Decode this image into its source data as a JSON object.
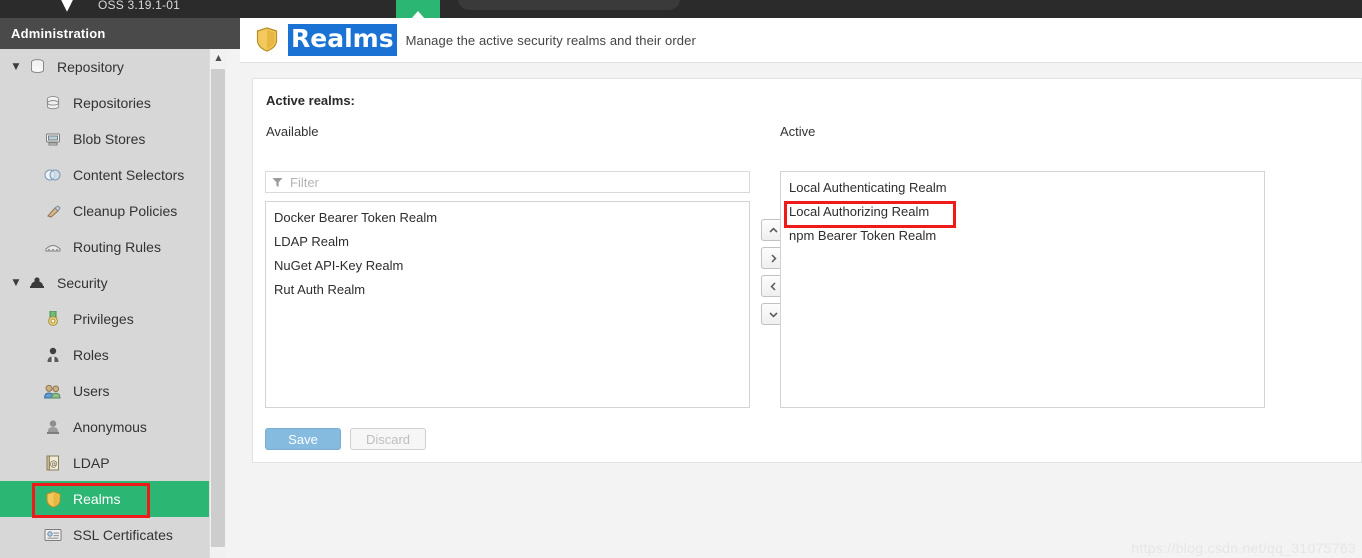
{
  "topbar": {
    "product_version": "OSS 3.19.1-01",
    "logo_icon": "chevron-down-logo-icon",
    "search_placeholder": "",
    "active_tab_icon": "green-active-tab-indicator"
  },
  "sidebar": {
    "header": "Administration",
    "groups": [
      {
        "label": "Repository",
        "icon": "database-icon",
        "caret": "▼",
        "items": [
          {
            "label": "Repositories",
            "icon": "database-icon"
          },
          {
            "label": "Blob Stores",
            "icon": "blob-store-icon"
          },
          {
            "label": "Content Selectors",
            "icon": "content-selector-icon"
          },
          {
            "label": "Cleanup Policies",
            "icon": "broom-icon"
          },
          {
            "label": "Routing Rules",
            "icon": "routing-rule-icon"
          }
        ]
      },
      {
        "label": "Security",
        "icon": "security-shield-icon",
        "caret": "▼",
        "items": [
          {
            "label": "Privileges",
            "icon": "privilege-medal-icon"
          },
          {
            "label": "Roles",
            "icon": "role-person-icon"
          },
          {
            "label": "Users",
            "icon": "users-icon"
          },
          {
            "label": "Anonymous",
            "icon": "anonymous-user-icon"
          },
          {
            "label": "LDAP",
            "icon": "ldap-book-icon"
          },
          {
            "label": "Realms",
            "icon": "realm-shield-icon",
            "selected": true
          },
          {
            "label": "SSL Certificates",
            "icon": "ssl-certificate-icon"
          }
        ]
      }
    ],
    "scrollbar": {
      "up_arrow_icon": "chevron-up-icon"
    },
    "selected_highlight_color": "#2cb673"
  },
  "page": {
    "icon": "realm-shield-icon",
    "title": "Realms",
    "title_highlight_color": "#1a73d4",
    "subtitle": "Manage the active security realms and their order"
  },
  "form": {
    "section_title": "Active realms:",
    "available": {
      "label": "Available",
      "filter": {
        "icon": "funnel-icon",
        "placeholder": "Filter",
        "value": ""
      },
      "items": [
        "Docker Bearer Token Realm",
        "LDAP Realm",
        "NuGet API-Key Realm",
        "Rut Auth Realm"
      ]
    },
    "active": {
      "label": "Active",
      "items": [
        "Local Authenticating Realm",
        "Local Authorizing Realm",
        "npm Bearer Token Realm"
      ],
      "highlighted_item": "npm Bearer Token Realm"
    },
    "transfer_buttons": [
      {
        "name": "move-up-button",
        "glyph": "ⱏ",
        "icon": "chevron-up-icon"
      },
      {
        "name": "move-right-button",
        "glyph": "❯",
        "icon": "chevron-right-icon"
      },
      {
        "name": "move-left-button",
        "glyph": "❮",
        "icon": "chevron-left-icon"
      },
      {
        "name": "move-down-button",
        "glyph": "ⱞ",
        "icon": "chevron-down-icon"
      }
    ],
    "buttons": {
      "save": "Save",
      "discard": "Discard",
      "save_color": "#85bbdf",
      "discard_disabled": true
    }
  },
  "annotations": {
    "color": "#ef1b1b",
    "boxes": [
      "realms-sidebar-item",
      "npm-bearer-token-realm-item"
    ]
  },
  "watermark": "https://blog.csdn.net/qq_31075763"
}
